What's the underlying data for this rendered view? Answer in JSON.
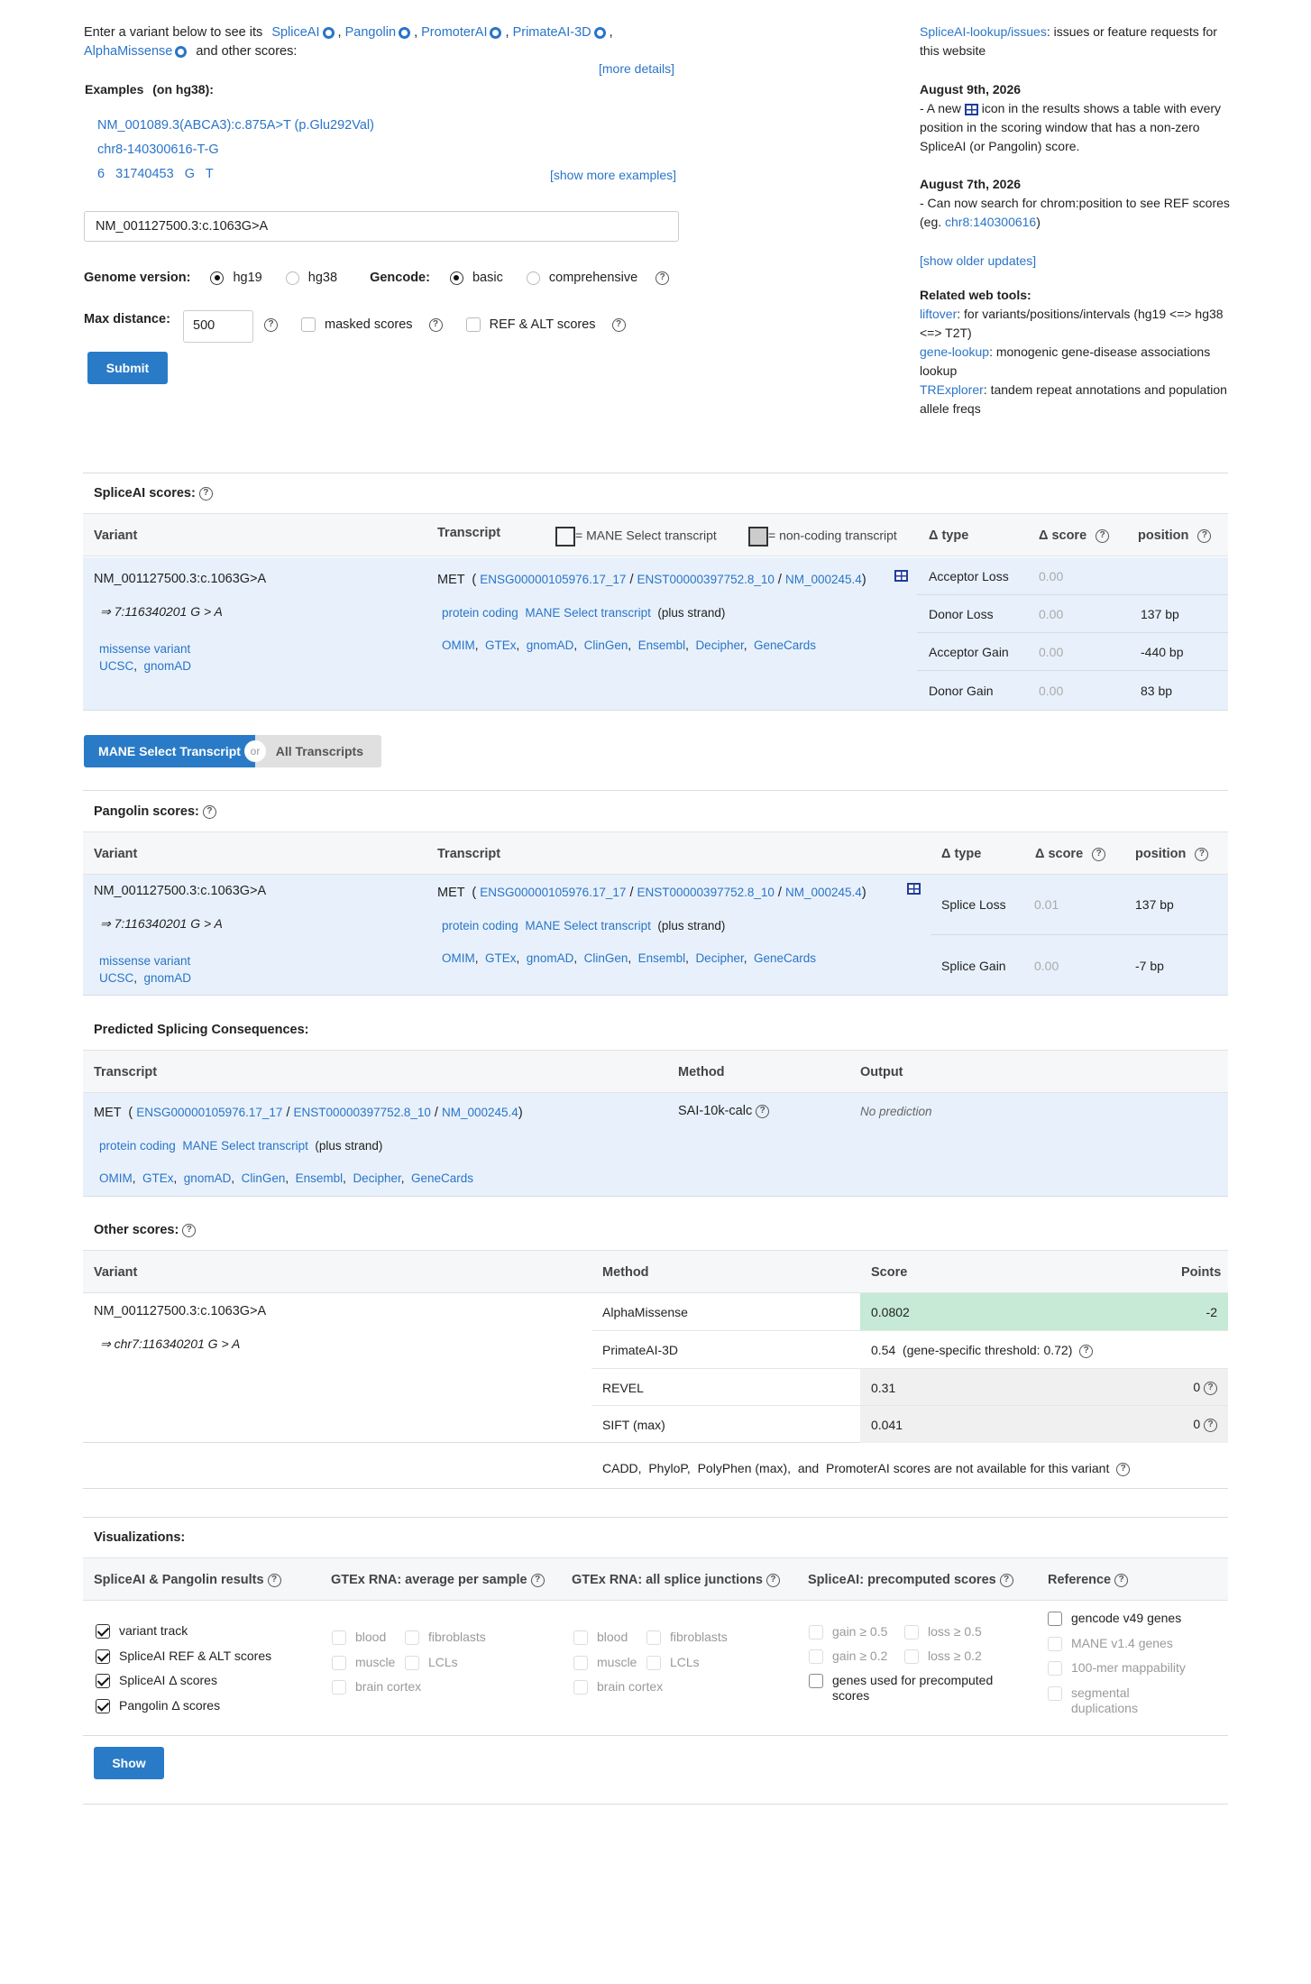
{
  "intro": {
    "text_before": "Enter a variant below to see its",
    "tools": [
      "SpliceAI",
      "Pangolin",
      "PromoterAI",
      "PrimateAI-3D",
      "AlphaMissense"
    ],
    "text_after": "and other scores:",
    "more_details": "[more details]",
    "examples_label": "Examples",
    "examples_build": "(on hg38):",
    "examples": [
      "NM_001089.3(ABCA3):c.875A>T (p.Glu292Val)",
      "chr8-140300616-T-G",
      "6   31740453   G   T"
    ],
    "show_more": "[show more examples]"
  },
  "form": {
    "variant_value": "NM_001127500.3:c.1063G>A",
    "genome_label": "Genome version:",
    "genome_options": [
      "hg19",
      "hg38"
    ],
    "genome_selected": "hg19",
    "gencode_label": "Gencode:",
    "gencode_options": [
      "basic",
      "comprehensive"
    ],
    "gencode_selected": "basic",
    "maxdist_label": "Max distance:",
    "maxdist_value": "500",
    "masked_label": "masked scores",
    "refalt_label": "REF & ALT scores",
    "submit": "Submit"
  },
  "sidebar": {
    "issues_link": "SpliceAI-lookup/issues",
    "issues_text": ": issues or feature requests for this website",
    "updates": [
      {
        "date": "August 9th, 2026",
        "text_a": "- A new",
        "text_b": "icon in the results shows a table with every position in the scoring window that has a non-zero SpliceAI (or Pangolin) score."
      },
      {
        "date": "August 7th, 2026",
        "text_a": "- Can now search for chrom:position to see REF scores (eg.",
        "link": "chr8:140300616",
        "text_b": ")"
      }
    ],
    "older_updates": "[show older updates]",
    "tools_title": "Related web tools:",
    "tools": [
      {
        "name": "liftover",
        "desc": ": for variants/positions/intervals (hg19 <=> hg38 <=> T2T)"
      },
      {
        "name": "gene-lookup",
        "desc": ": monogenic gene-disease associations lookup"
      },
      {
        "name": "TRExplorer",
        "desc": ": tandem repeat annotations and population allele freqs"
      }
    ]
  },
  "spliceai": {
    "title": "SpliceAI scores:",
    "headers": {
      "variant": "Variant",
      "transcript": "Transcript",
      "mane_legend": "= MANE Select transcript",
      "noncoding_legend": "= non-coding transcript",
      "dtype": "Δ type",
      "dscore": "Δ score",
      "position": "position"
    },
    "variant": "NM_001127500.3:c.1063G>A",
    "variant_genomic": "⇒ 7:116340201 G > A",
    "consequence": "missense variant",
    "links": [
      "UCSC",
      "gnomAD"
    ],
    "gene": "MET",
    "ids": [
      "ENSG00000105976.17_17",
      "ENST00000397752.8_10",
      "NM_000245.4"
    ],
    "biotype": "protein coding",
    "mane": "MANE Select transcript",
    "strand": "(plus strand)",
    "db_links": [
      "OMIM",
      "GTEx",
      "gnomAD",
      "ClinGen",
      "Ensembl",
      "Decipher",
      "GeneCards"
    ],
    "rows": [
      {
        "type": "Acceptor Loss",
        "score": "0.00",
        "pos": ""
      },
      {
        "type": "Donor Loss",
        "score": "0.00",
        "pos": "137 bp"
      },
      {
        "type": "Acceptor Gain",
        "score": "0.00",
        "pos": "-440 bp"
      },
      {
        "type": "Donor Gain",
        "score": "0.00",
        "pos": "83 bp"
      }
    ]
  },
  "toggle": {
    "mane": "MANE Select Transcript",
    "or": "or",
    "all": "All Transcripts"
  },
  "pangolin": {
    "title": "Pangolin scores:",
    "headers": {
      "variant": "Variant",
      "transcript": "Transcript",
      "dtype": "Δ type",
      "dscore": "Δ score",
      "position": "position"
    },
    "variant": "NM_001127500.3:c.1063G>A",
    "variant_genomic": "⇒ 7:116340201 G > A",
    "consequence": "missense variant",
    "links": [
      "UCSC",
      "gnomAD"
    ],
    "gene": "MET",
    "ids": [
      "ENSG00000105976.17_17",
      "ENST00000397752.8_10",
      "NM_000245.4"
    ],
    "biotype": "protein coding",
    "mane": "MANE Select transcript",
    "strand": "(plus strand)",
    "db_links": [
      "OMIM",
      "GTEx",
      "gnomAD",
      "ClinGen",
      "Ensembl",
      "Decipher",
      "GeneCards"
    ],
    "rows": [
      {
        "type": "Splice Loss",
        "score": "0.01",
        "pos": "137 bp"
      },
      {
        "type": "Splice Gain",
        "score": "0.00",
        "pos": "-7 bp"
      }
    ]
  },
  "consequences": {
    "title": "Predicted Splicing Consequences:",
    "headers": {
      "transcript": "Transcript",
      "method": "Method",
      "output": "Output"
    },
    "gene": "MET",
    "ids": [
      "ENSG00000105976.17_17",
      "ENST00000397752.8_10",
      "NM_000245.4"
    ],
    "biotype": "protein coding",
    "mane": "MANE Select transcript",
    "strand": "(plus strand)",
    "db_links": [
      "OMIM",
      "GTEx",
      "gnomAD",
      "ClinGen",
      "Ensembl",
      "Decipher",
      "GeneCards"
    ],
    "method": "SAI-10k-calc",
    "output": "No prediction"
  },
  "other": {
    "title": "Other scores:",
    "headers": {
      "variant": "Variant",
      "method": "Method",
      "score": "Score",
      "points": "Points"
    },
    "variant": "NM_001127500.3:c.1063G>A",
    "variant_genomic": "⇒ chr7:116340201 G > A",
    "rows": [
      {
        "method": "AlphaMissense",
        "score": "0.0802",
        "points": "-2"
      },
      {
        "method": "PrimateAI-3D",
        "score": "0.54",
        "extra": "(gene-specific threshold: 0.72)",
        "points": ""
      },
      {
        "method": "REVEL",
        "score": "0.31",
        "points": "0"
      },
      {
        "method": "SIFT (max)",
        "score": "0.041",
        "points": "0"
      }
    ],
    "unavailable": [
      "CADD",
      "PhyloP",
      "PolyPhen (max)",
      "PromoterAI"
    ],
    "unavailable_suffix": "scores are not available for this variant",
    "highlight_color": "#c6ead5"
  },
  "viz": {
    "title": "Visualizations:",
    "columns": [
      {
        "title": "SpliceAI & Pangolin results",
        "items": [
          [
            "variant track"
          ],
          [
            "SpliceAI REF & ALT scores"
          ],
          [
            "SpliceAI Δ scores"
          ],
          [
            "Pangolin Δ scores"
          ]
        ]
      },
      {
        "title": "GTEx RNA: average per sample",
        "items": [
          [
            "blood",
            "fibroblasts"
          ],
          [
            "muscle",
            "LCLs"
          ],
          [
            "brain cortex"
          ]
        ]
      },
      {
        "title": "GTEx RNA: all splice junctions",
        "items": [
          [
            "blood",
            "fibroblasts"
          ],
          [
            "muscle",
            "LCLs"
          ],
          [
            "brain cortex"
          ]
        ]
      },
      {
        "title": "SpliceAI: precomputed scores",
        "items": [
          [
            "gain ≥ 0.5",
            "loss ≥ 0.5"
          ],
          [
            "gain ≥ 0.2",
            "loss ≥ 0.2"
          ],
          [
            "genes used for precomputed scores"
          ]
        ]
      },
      {
        "title": "Reference",
        "items": [
          [
            "gencode v49 genes"
          ],
          [
            "MANE v1.4 genes"
          ],
          [
            "100-mer mappability"
          ],
          [
            "segmental duplications"
          ]
        ]
      }
    ],
    "show": "Show"
  },
  "colors": {
    "link": "#2a74c8",
    "accent": "#2a7bc7",
    "row_bg": "#e8f1fb",
    "header_bg": "#f6f7f8"
  }
}
